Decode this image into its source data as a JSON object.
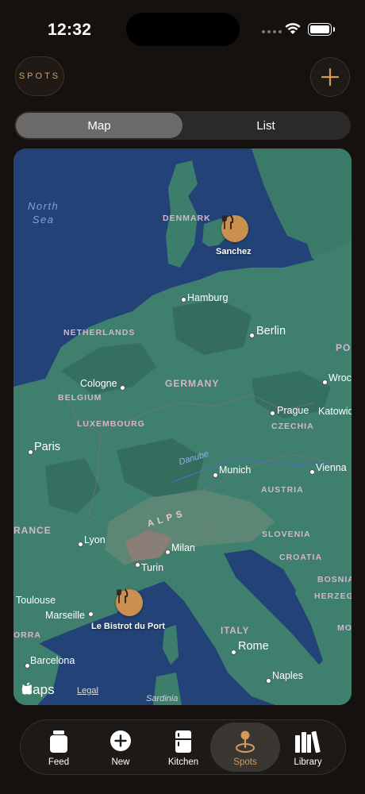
{
  "status": {
    "time": "12:32"
  },
  "header": {
    "spots_label": "SPOTS",
    "add_icon": "plus-icon"
  },
  "segments": {
    "map_label": "Map",
    "list_label": "List",
    "selected": "Map"
  },
  "map": {
    "seas": {
      "north_sea_line1": "North",
      "north_sea_line2": "Sea"
    },
    "countries": {
      "denmark": "DENMARK",
      "netherlands": "NETHERLANDS",
      "germany": "GERMANY",
      "belgium": "BELGIUM",
      "luxembourg": "LUXEMBOURG",
      "czechia": "CZECHIA",
      "austria": "AUSTRIA",
      "slovenia": "SLOVENIA",
      "croatia": "CROATIA",
      "bosnia": "BOSNIA",
      "herzeg": "HERZEGO",
      "france": "RANCE",
      "italy": "ITALY",
      "poland": "PO",
      "corsica": "ORRA",
      "mo": "MO"
    },
    "cities": {
      "hamburg": "Hamburg",
      "berlin": "Berlin",
      "cologne": "Cologne",
      "paris": "Paris",
      "prague": "Prague",
      "wroclaw": "Wroc",
      "katowice": "Katowic",
      "munich": "Munich",
      "vienna": "Vienna",
      "lyon": "Lyon",
      "milan": "Milan",
      "turin": "Turin",
      "toulouse": "Toulouse",
      "marseille": "Marseille",
      "rome": "Rome",
      "barcelona": "Barcelona",
      "naples": "Naples",
      "sardinia": "Sardinia"
    },
    "features": {
      "river": "Danube",
      "mountains": "A  L  P  S"
    },
    "spots": [
      {
        "name": "Sanchez",
        "icon": "fork-knife-icon"
      },
      {
        "name": "Le Bistrot du Port",
        "icon": "fork-knife-icon"
      }
    ],
    "attribution": {
      "logo": "Maps",
      "legal": "Legal"
    }
  },
  "tabs": [
    {
      "label": "Feed",
      "icon": "jar-icon"
    },
    {
      "label": "New",
      "icon": "plus-circle-icon"
    },
    {
      "label": "Kitchen",
      "icon": "fridge-icon"
    },
    {
      "label": "Spots",
      "icon": "map-pin-icon",
      "active": true
    },
    {
      "label": "Library",
      "icon": "books-icon"
    }
  ],
  "colors": {
    "accent": "#d29a5c",
    "background": "#15110e",
    "land": "#3d7d6c",
    "water": "#234277"
  }
}
